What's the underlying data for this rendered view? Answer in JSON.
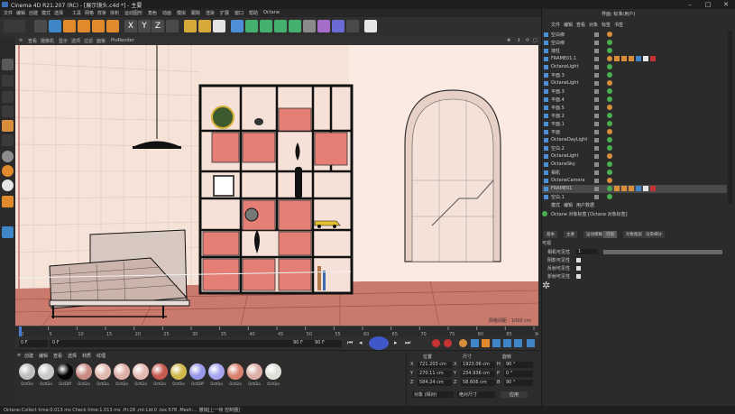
{
  "window": {
    "title": "Cinema 4D R21.207 (RC) - [展示镜头.c4d *] - 主要"
  },
  "menu": [
    "文件",
    "编辑",
    "创建",
    "模式",
    "选择",
    "工具",
    "网格",
    "样条",
    "体积",
    "运动图形",
    "角色",
    "动画",
    "模拟",
    "跟踪",
    "渲染",
    "扩展",
    "窗口",
    "帮助",
    "Octane"
  ],
  "layout_label": "界面: 标准(用户)",
  "viewport_menu": [
    "查看",
    "摄像机",
    "显示",
    "选项",
    "过滤",
    "面板",
    "ProRender"
  ],
  "viewport_grid_label": "网格间距 : 1000 cm",
  "timeline": {
    "ticks": [
      "0",
      "5",
      "10",
      "15",
      "20",
      "25",
      "30",
      "35",
      "40",
      "45",
      "50",
      "55",
      "60",
      "65",
      "70",
      "75",
      "80",
      "85",
      "90"
    ],
    "end_field": "0 F",
    "start_field": "0 F",
    "current_field": "0 F",
    "max_field": "90 F",
    "max_field2": "90 F"
  },
  "materials": {
    "menu": [
      "创建",
      "编辑",
      "查看",
      "选择",
      "材质",
      "纹理"
    ],
    "items": [
      {
        "label": "OctGlo",
        "color": "#bdbdbd"
      },
      {
        "label": "OctGlo",
        "color": "#c9c9c9"
      },
      {
        "label": "OctDiff",
        "color": "#050505"
      },
      {
        "label": "OctGlo",
        "color": "#c98b83"
      },
      {
        "label": "OctGlo",
        "color": "#e1b8b0"
      },
      {
        "label": "OctGlo",
        "color": "#dcb0a6"
      },
      {
        "label": "OctGlo",
        "color": "#e3bab2"
      },
      {
        "label": "OctGlo",
        "color": "#c65a50"
      },
      {
        "label": "OctGlo",
        "color": "#d0b84a"
      },
      {
        "label": "OctDiff",
        "color": "#9898ea"
      },
      {
        "label": "OctGlo",
        "color": "#a6a6f0"
      },
      {
        "label": "OctGlo",
        "color": "#d9826f"
      },
      {
        "label": "OctGlo",
        "color": "#dcaea6"
      },
      {
        "label": "OctGlo",
        "color": "#e0ded8"
      }
    ]
  },
  "coords": {
    "header": [
      "位置",
      "尺寸",
      "旋转"
    ],
    "rows": [
      {
        "axis": "X",
        "pos": "721.203 cm",
        "size": "1923.06 cm",
        "rotl": "H",
        "rot": "90 °"
      },
      {
        "axis": "Y",
        "pos": "270.11 cm",
        "size": "234.936 cm",
        "rotl": "P",
        "rot": "0 °"
      },
      {
        "axis": "Z",
        "pos": "584.24 cm",
        "size": "58.606 cm",
        "rotl": "B",
        "rot": "90 °"
      }
    ],
    "mode_select": "对象 (相对)",
    "size_select": "绝对尺寸",
    "apply": "应用"
  },
  "objects": {
    "tabs": [
      "文件",
      "编辑",
      "查看",
      "对象",
      "标签",
      "书签"
    ],
    "rows": [
      {
        "name": "空白绑",
        "sel": false
      },
      {
        "name": "空白绑",
        "sel": false
      },
      {
        "name": "墙柱",
        "sel": false
      },
      {
        "name": "FRAME01.1",
        "sel": false
      },
      {
        "name": "OctaneLight",
        "sel": false
      },
      {
        "name": "平面.3",
        "sel": false
      },
      {
        "name": "OctaneLight",
        "sel": false
      },
      {
        "name": "平面.3",
        "sel": false
      },
      {
        "name": "平面.4",
        "sel": false
      },
      {
        "name": "平面.5",
        "sel": false
      },
      {
        "name": "平面.2",
        "sel": false
      },
      {
        "name": "平面.1",
        "sel": false
      },
      {
        "name": "平面",
        "sel": false
      },
      {
        "name": "OctaneDayLight",
        "sel": false
      },
      {
        "name": "空白.2",
        "sel": false
      },
      {
        "name": "OctaneLight",
        "sel": false
      },
      {
        "name": "OctaneSky",
        "sel": false
      },
      {
        "name": "相机",
        "sel": false
      },
      {
        "name": "OctaneCamera",
        "sel": false
      },
      {
        "name": "FRAME01",
        "sel": true
      },
      {
        "name": "空白.1",
        "sel": false
      }
    ]
  },
  "attributes": {
    "tabs_top": [
      "模式",
      "编辑",
      "用户数据"
    ],
    "object_title": "Octane 对象标签 [Octane 对象标签]",
    "tabs": [
      "基本",
      "主要",
      "运动模糊",
      "可视",
      "对象图层",
      "渲染细分"
    ],
    "section": "可视",
    "fields": [
      {
        "label": "相机可见性",
        "value": "1"
      },
      {
        "label": "阴影可见性",
        "value": ""
      },
      {
        "label": "反射可见性",
        "value": ""
      },
      {
        "label": "折射可见性",
        "value": ""
      }
    ]
  },
  "status": "Octane:Collect time:0.013 ms  Check time:1.013 ms  ,Hi:28  ,mt:Lld:0  ,tex:578  ,Mesh:...  撤销[上一帧 控制器]"
}
